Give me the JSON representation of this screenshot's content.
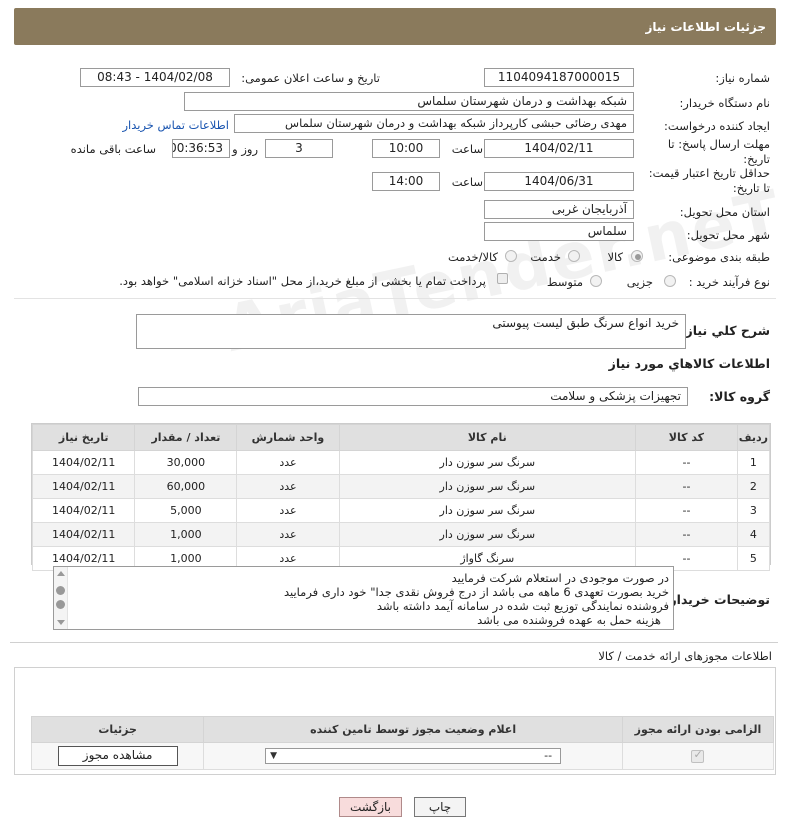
{
  "header": {
    "title": "جزئیات اطلاعات نیاز"
  },
  "form": {
    "need_number_label": "شماره نیاز:",
    "need_number": "1104094187000015",
    "announce_label": "تاریخ و ساعت اعلان عمومی:",
    "announce_value": "1404/02/08 - 08:43",
    "buyer_org_label": "نام دستگاه خریدار:",
    "buyer_org": "شبکه بهداشت و درمان  شهرستان سلماس",
    "creator_label": "ایجاد کننده درخواست:",
    "creator": "مهدی رضائی حبشی کارپرداز شبکه بهداشت و درمان  شهرستان سلماس",
    "contact_link": "اطلاعات تماس خریدار",
    "reply_deadline_label": "مهلت ارسال پاسخ: تا تاریخ:",
    "reply_date": "1404/02/11",
    "time_label": "ساعت",
    "reply_time": "10:00",
    "days_value": "3",
    "days_label": "روز و",
    "remaining_value": "00:36:53",
    "remaining_label": "ساعت باقی مانده",
    "validity_label": "حداقل تاریخ اعتبار قیمت: تا تاریخ:",
    "validity_date": "1404/06/31",
    "validity_time": "14:00",
    "province_label": "استان محل تحویل:",
    "province": "آذربایجان غربی",
    "city_label": "شهر محل تحویل:",
    "city": "سلماس",
    "category_label": "طبقه بندی موضوعی:",
    "category_options": [
      "کالا",
      "خدمت",
      "کالا/خدمت"
    ],
    "process_label": "نوع فرآیند خرید :",
    "process_options": [
      "جزیی",
      "متوسط"
    ],
    "payment_note": "پرداخت تمام یا بخشی از مبلغ خرید،از محل \"اسناد خزانه اسلامی\" خواهد بود."
  },
  "description": {
    "label": "شرح کلي نياز:",
    "value": "خرید انواع سرنگ طبق لیست پیوستی"
  },
  "goods": {
    "section_title": "اطلاعات کالاهاي مورد نياز",
    "group_label": "گروه کالا:",
    "group_value": "تجهیزات پزشکی و سلامت",
    "columns": [
      "ردیف",
      "کد کالا",
      "نام کالا",
      "واحد شمارش",
      "تعداد / مقدار",
      "تاریخ نیاز"
    ],
    "rows": [
      [
        "1",
        "--",
        "سرنگ سر سوزن دار",
        "عدد",
        "30,000",
        "1404/02/11"
      ],
      [
        "2",
        "--",
        "سرنگ سر سوزن دار",
        "عدد",
        "60,000",
        "1404/02/11"
      ],
      [
        "3",
        "--",
        "سرنگ سر سوزن دار",
        "عدد",
        "5,000",
        "1404/02/11"
      ],
      [
        "4",
        "--",
        "سرنگ سر سوزن دار",
        "عدد",
        "1,000",
        "1404/02/11"
      ],
      [
        "5",
        "--",
        "سرنگ گاواژ",
        "عدد",
        "1,000",
        "1404/02/11"
      ]
    ]
  },
  "buyer_notes": {
    "label": "توضیحات خریدار:",
    "lines": [
      "در صورت موجودی در استعلام شرکت فرمایید",
      "خرید بصورت تعهدی 6 ماهه می باشد از درج فروش نقدی جدا\" خود داری فرمایید",
      "فروشنده نمایندگی توزیع ثبت شده در سامانه آیمد داشته باشد",
      "هزینه حمل به عهده فروشنده می باشد"
    ]
  },
  "licenses": {
    "section_title": "اطلاعات مجوزهای ارائه خدمت / کالا",
    "columns": [
      "الزامی بودن ارائه مجوز",
      "اعلام وضعیت مجوز توسط تامین کننده",
      "جزئیات"
    ],
    "select_value": "--",
    "view_button": "مشاهده مجوز"
  },
  "footer": {
    "print_button": "چاپ",
    "back_button": "بازگشت"
  },
  "watermark": "AriaTender.neT"
}
